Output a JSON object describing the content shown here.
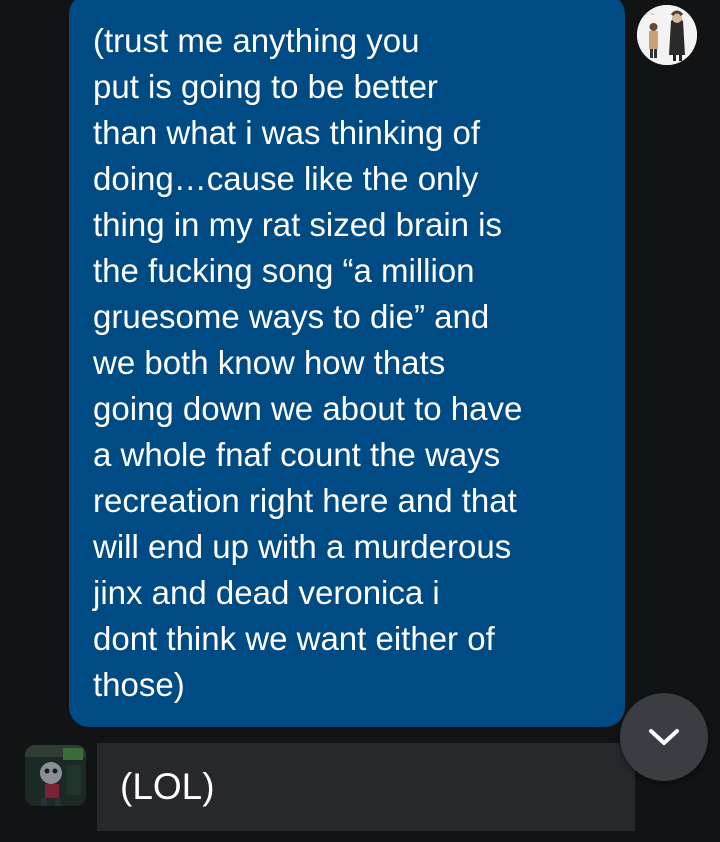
{
  "messages": {
    "outgoing": {
      "text": "(trust me anything you\nput is going to be better\nthan what i was thinking of\ndoing…cause like the only\nthing in my rat sized brain is\nthe fucking song “a million\ngruesome ways to die” and\nwe both know how thats\ngoing down we about to have\na whole fnaf count the ways\nrecreation right here and that\nwill end up with a murderous\njinx and dead veronica i\ndont think we want either of\nthose)"
    },
    "incoming": {
      "text": "(LOL)"
    }
  },
  "icons": {
    "scroll_down": "chevron-down-icon"
  },
  "colors": {
    "background": "#121314",
    "outgoing_bubble": "#004b83",
    "incoming_bubble": "#26282b",
    "scroll_button": "#3a3d42"
  }
}
